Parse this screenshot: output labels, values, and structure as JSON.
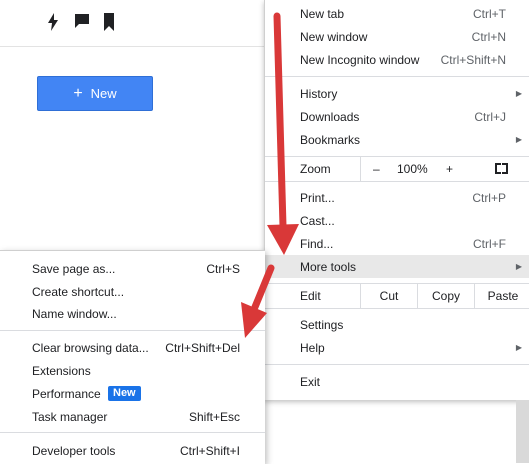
{
  "toolbar": {
    "icons": [
      "lightning-icon",
      "comment-icon",
      "bookmark-icon"
    ]
  },
  "new_button": {
    "plus": "+",
    "label": "New",
    "color": "#4285f4"
  },
  "main_menu": {
    "new_tab": {
      "label": "New tab",
      "shortcut": "Ctrl+T"
    },
    "new_window": {
      "label": "New window",
      "shortcut": "Ctrl+N"
    },
    "new_incognito": {
      "label": "New Incognito window",
      "shortcut": "Ctrl+Shift+N"
    },
    "history": {
      "label": "History"
    },
    "downloads": {
      "label": "Downloads",
      "shortcut": "Ctrl+J"
    },
    "bookmarks": {
      "label": "Bookmarks"
    },
    "zoom": {
      "label": "Zoom",
      "minus": "–",
      "value": "100%",
      "plus": "+"
    },
    "print": {
      "label": "Print...",
      "shortcut": "Ctrl+P"
    },
    "cast": {
      "label": "Cast..."
    },
    "find": {
      "label": "Find...",
      "shortcut": "Ctrl+F"
    },
    "more_tools": {
      "label": "More tools"
    },
    "edit": {
      "label": "Edit",
      "cut": "Cut",
      "copy": "Copy",
      "paste": "Paste"
    },
    "settings": {
      "label": "Settings"
    },
    "help": {
      "label": "Help"
    },
    "exit": {
      "label": "Exit"
    }
  },
  "sub_menu": {
    "save_page": {
      "label": "Save page as...",
      "shortcut": "Ctrl+S"
    },
    "create_shortcut": {
      "label": "Create shortcut..."
    },
    "name_window": {
      "label": "Name window..."
    },
    "clear_data": {
      "label": "Clear browsing data...",
      "shortcut": "Ctrl+Shift+Del"
    },
    "extensions": {
      "label": "Extensions"
    },
    "performance": {
      "label": "Performance",
      "badge": "New"
    },
    "task_manager": {
      "label": "Task manager",
      "shortcut": "Shift+Esc"
    },
    "developer_tools": {
      "label": "Developer tools",
      "shortcut": "Ctrl+Shift+I"
    }
  },
  "colors": {
    "arrow": "#d93838",
    "badge": "#1a73e8",
    "highlight": "#e8e8e8"
  }
}
